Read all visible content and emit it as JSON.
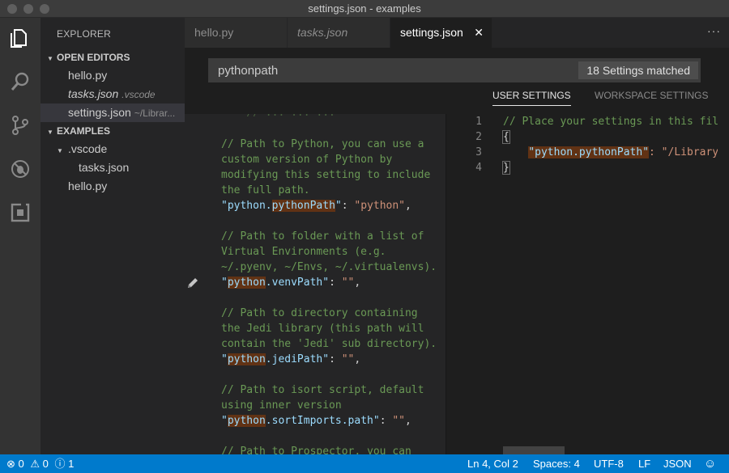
{
  "window": {
    "title": "settings.json - examples"
  },
  "activity": {
    "icons": [
      "files-icon",
      "search-icon",
      "source-control-icon",
      "debug-icon",
      "extensions-icon"
    ]
  },
  "sidebar": {
    "header": "EXPLORER",
    "open_editors": {
      "label": "OPEN EDITORS",
      "items": [
        {
          "name": "hello.py",
          "detail": ""
        },
        {
          "name": "tasks.json",
          "detail": ".vscode"
        },
        {
          "name": "settings.json",
          "detail": "~/Librar..."
        }
      ]
    },
    "examples": {
      "label": "EXAMPLES",
      "folder": ".vscode",
      "folder_child": "tasks.json",
      "file": "hello.py"
    }
  },
  "tabs": [
    {
      "label": "hello.py"
    },
    {
      "label": "tasks.json"
    },
    {
      "label": "settings.json",
      "close": "✕"
    }
  ],
  "more_actions": "···",
  "search": {
    "value": "pythonpath",
    "count": "18 Settings matched"
  },
  "settings_tabs": {
    "user": "USER SETTINGS",
    "workspace": "WORKSPACE SETTINGS"
  },
  "defaults": {
    "top_partial": "    // ... ... ...",
    "blocks": [
      {
        "comment": [
          "// Path to Python, you can use a",
          "custom version of Python by",
          "modifying this setting to include",
          "the full path."
        ],
        "key_pre": "python.",
        "key_hl": "pythonPath",
        "key_post": "",
        "value": "\"python\""
      },
      {
        "comment": [
          "// Path to folder with a list of",
          "Virtual Environments (e.g.",
          "~/.pyenv, ~/Envs, ~/.virtualenvs)."
        ],
        "key_pre": "",
        "key_hl": "python",
        "key_post": ".venvPath",
        "value": "\"\""
      },
      {
        "comment": [
          "// Path to directory containing",
          "the Jedi library (this path will",
          "contain the 'Jedi' sub directory)."
        ],
        "key_pre": "",
        "key_hl": "python",
        "key_post": ".jediPath",
        "value": "\"\""
      },
      {
        "comment": [
          "// Path to isort script, default",
          "using inner version"
        ],
        "key_pre": "",
        "key_hl": "python",
        "key_post": ".sortImports.path",
        "value": "\"\""
      }
    ],
    "bottom_partial": "// Path to Prospector, you can"
  },
  "user_settings": {
    "line1": "// Place your settings in this file t",
    "line2": "{",
    "line3_key": "\"python.pythonPath\"",
    "line3_rest": ": \"/Library/Fr",
    "line4": "}",
    "line_numbers": [
      "1",
      "2",
      "3",
      "4"
    ]
  },
  "status": {
    "errors": "0",
    "warnings": "0",
    "info": "1",
    "position": "Ln 4, Col 2",
    "spaces": "Spaces: 4",
    "encoding": "UTF-8",
    "eol": "LF",
    "language": "JSON"
  },
  "colors": {
    "status_bar": "#007acc",
    "highlight": "#613214",
    "comment": "#6a9955",
    "key": "#9cdcfe",
    "string": "#ce9178"
  }
}
